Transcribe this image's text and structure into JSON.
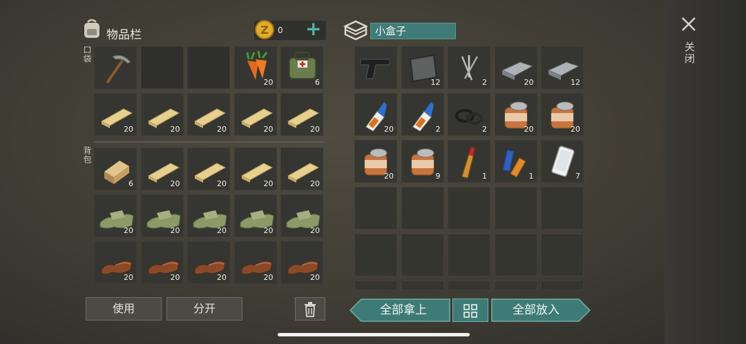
{
  "inventory": {
    "title": "物品栏",
    "coins": "0",
    "add_label": "+",
    "pocket_label": "口袋",
    "backpack_label": "背包",
    "pocket_slots": [
      {
        "icon": "pickaxe",
        "qty": ""
      },
      {
        "icon": "",
        "qty": ""
      },
      {
        "icon": "",
        "qty": ""
      },
      {
        "icon": "carrot",
        "qty": "20"
      },
      {
        "icon": "medkit-bag",
        "qty": "6"
      },
      {
        "icon": "plank",
        "qty": "20"
      },
      {
        "icon": "plank",
        "qty": "20"
      },
      {
        "icon": "plank",
        "qty": "20"
      },
      {
        "icon": "plank",
        "qty": "20"
      },
      {
        "icon": "plank",
        "qty": "20"
      }
    ],
    "backpack_slots": [
      {
        "icon": "log",
        "qty": "6"
      },
      {
        "icon": "plank",
        "qty": "20"
      },
      {
        "icon": "plank",
        "qty": "20"
      },
      {
        "icon": "plank",
        "qty": "20"
      },
      {
        "icon": "plank",
        "qty": "20"
      },
      {
        "icon": "cloth",
        "qty": "20"
      },
      {
        "icon": "cloth",
        "qty": "20"
      },
      {
        "icon": "cloth",
        "qty": "20"
      },
      {
        "icon": "cloth",
        "qty": "20"
      },
      {
        "icon": "cloth",
        "qty": "20"
      },
      {
        "icon": "leather",
        "qty": "20"
      },
      {
        "icon": "leather",
        "qty": "20"
      },
      {
        "icon": "leather",
        "qty": "20"
      },
      {
        "icon": "leather",
        "qty": "20"
      },
      {
        "icon": "leather",
        "qty": "20"
      }
    ],
    "use_label": "使用",
    "split_label": "分开"
  },
  "container": {
    "title": "小盒子",
    "slots": [
      {
        "icon": "pistol",
        "qty": ""
      },
      {
        "icon": "metal-plate",
        "qty": "12"
      },
      {
        "icon": "nails",
        "qty": "2"
      },
      {
        "icon": "iron-bar",
        "qty": "20"
      },
      {
        "icon": "iron-bar",
        "qty": "12"
      },
      {
        "icon": "glue",
        "qty": "20"
      },
      {
        "icon": "glue",
        "qty": "2"
      },
      {
        "icon": "rubber-ring",
        "qty": "2"
      },
      {
        "icon": "tin-can",
        "qty": "20"
      },
      {
        "icon": "tin-can",
        "qty": "20"
      },
      {
        "icon": "tin-can",
        "qty": "20"
      },
      {
        "icon": "tin-can",
        "qty": "9"
      },
      {
        "icon": "bottle",
        "qty": "1"
      },
      {
        "icon": "batteries",
        "qty": "1"
      },
      {
        "icon": "phone",
        "qty": "7"
      }
    ],
    "take_all_label": "全部拿上",
    "put_all_label": "全部放入"
  },
  "close_label": "关闭",
  "colors": {
    "teal": "#3e7b76",
    "coin": "#e0ad2a"
  }
}
